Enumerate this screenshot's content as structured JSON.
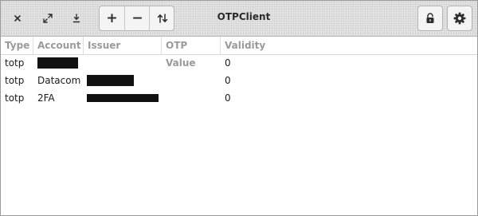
{
  "app": {
    "title": "OTPClient"
  },
  "toolbar": {
    "close_icon": "close-icon",
    "expand_icon": "expand-icon",
    "download_icon": "download-icon",
    "add_label": "+",
    "remove_label": "−",
    "sort_icon": "sort-arrows-icon",
    "lock_icon": "lock-icon",
    "settings_icon": "gear-icon"
  },
  "table": {
    "columns": [
      "Type",
      "Account",
      "Issuer",
      "OTP Value",
      "Validity"
    ],
    "rows": [
      {
        "type": "totp",
        "account": "",
        "account_redacted": true,
        "issuer": "",
        "issuer_redacted": false,
        "otp_value": "",
        "validity": "0"
      },
      {
        "type": "totp",
        "account": "Datacom",
        "account_redacted": false,
        "issuer": "",
        "issuer_redacted": true,
        "otp_value": "",
        "validity": "0"
      },
      {
        "type": "totp",
        "account": "2FA",
        "account_redacted": false,
        "issuer": "",
        "issuer_redacted": true,
        "otp_value": "",
        "validity": "0"
      }
    ]
  },
  "colors": {
    "header_bg": "#e2e2e2",
    "column_header_text": "#9a9a9a",
    "redaction": "#111111"
  }
}
